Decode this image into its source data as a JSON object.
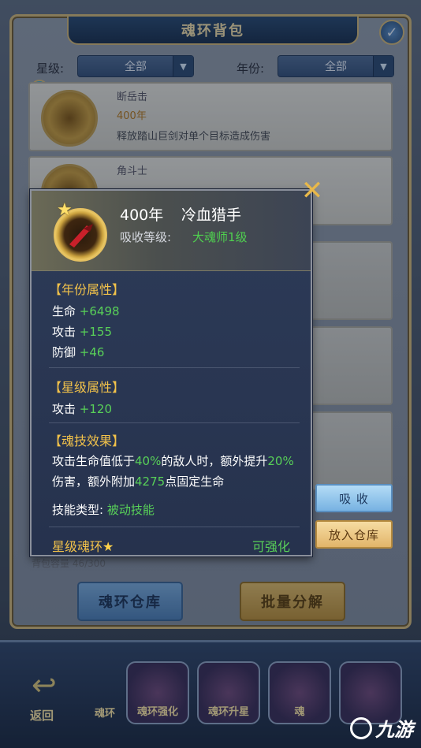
{
  "bag": {
    "title": "魂环背包",
    "close_icon": "✓",
    "filter_star_label": "星级:",
    "filter_star_value": "全部",
    "filter_year_label": "年份:",
    "filter_year_value": "全部",
    "cards": [
      {
        "name": "断岳击",
        "year": "400年",
        "desc": "释放踏山巨剑对单个目标造成伤害"
      },
      {
        "name": "角斗士",
        "year": "",
        "desc": ""
      }
    ],
    "capacity": "背包容量 46/300",
    "warehouse_button": "魂环仓库",
    "split_button": "批量分解"
  },
  "bottom_bar": {
    "back_label": "返回",
    "items": [
      {
        "label": "魂环"
      },
      {
        "label": "魂环强化"
      },
      {
        "label": "魂环升星"
      },
      {
        "label": "魂"
      },
      {
        "label": ""
      }
    ]
  },
  "watermark": "九游",
  "popup": {
    "year": "400年",
    "name": "冷血猎手",
    "absorb_label": "吸收等级:",
    "absorb_value": "大魂师1级",
    "year_attr_title": "【年份属性】",
    "year_attrs": [
      {
        "label": "生命",
        "value": "+6498"
      },
      {
        "label": "攻击",
        "value": "+155"
      },
      {
        "label": "防御",
        "value": "+46"
      }
    ],
    "star_attr_title": "【星级属性】",
    "star_attrs": [
      {
        "label": "攻击",
        "value": "+120"
      }
    ],
    "skill_title": "【魂技效果】",
    "skill_desc_1": "攻击生命值低于",
    "skill_desc_2": "40%",
    "skill_desc_3": "的敌人时，额外提升",
    "skill_desc_4": "20%",
    "skill_desc_5": "伤害，额外附加",
    "skill_desc_6": "4275",
    "skill_desc_7": "点固定生命",
    "skill_type_label": "技能类型:",
    "skill_type_value": "被动技能",
    "footer_left": "星级魂环",
    "footer_star": "★",
    "footer_right": "可强化"
  },
  "actions": {
    "absorb": "吸 收",
    "store": "放入仓库"
  },
  "colors": {
    "accent_gold": "#f2c24a",
    "value_green": "#58d058",
    "popup_bg": "#2d3b58"
  }
}
